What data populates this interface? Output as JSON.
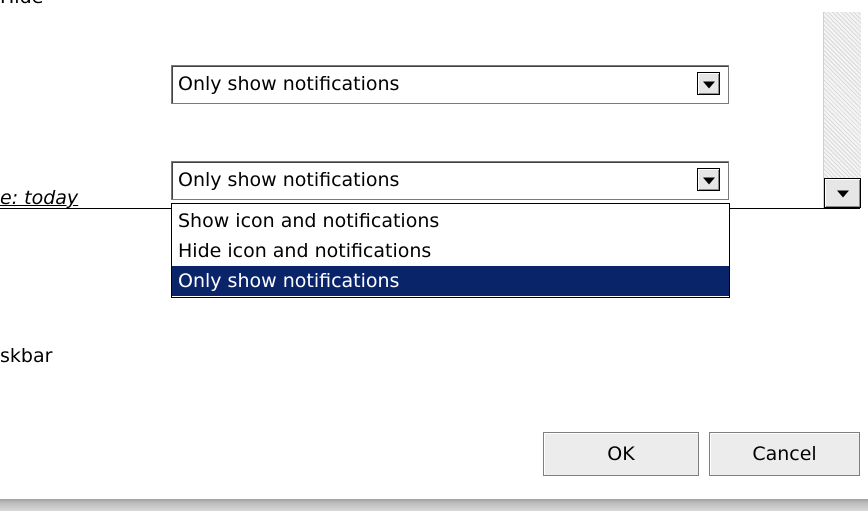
{
  "top_clipped_text": "Hide",
  "combo1": {
    "value": "Only show notifications"
  },
  "combo2": {
    "value": "Only show notifications",
    "left_label": "e: today"
  },
  "dropdown": {
    "options": [
      "Show icon and notifications",
      "Hide icon and notifications",
      "Only show notifications"
    ],
    "selected_index": 2
  },
  "taskbar_label": "skbar",
  "buttons": {
    "ok": "OK",
    "cancel": "Cancel"
  },
  "colors": {
    "selection_bg": "#0a246a",
    "selection_fg": "#ffffff"
  }
}
